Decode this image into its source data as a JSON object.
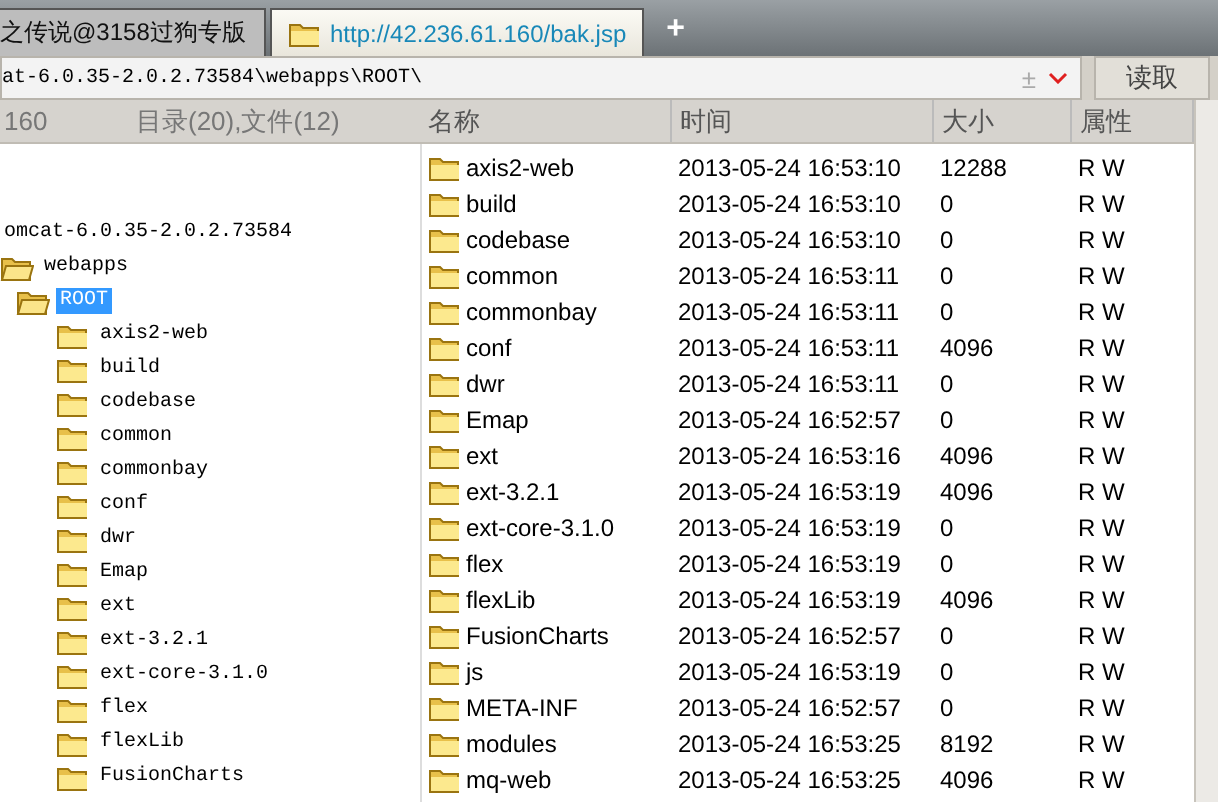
{
  "tabs": [
    {
      "label": "之传说@3158过狗专版",
      "selected": false
    },
    {
      "label": "http://42.236.61.160/bak.jsp",
      "selected": true
    }
  ],
  "new_tab": "+",
  "address": {
    "value": "at-6.0.35-2.0.2.73584\\webapps\\ROOT\\",
    "toggle": "±",
    "button": "读取"
  },
  "left_header": {
    "ip": "160",
    "summary": "目录(20),文件(12)"
  },
  "tree": [
    {
      "name": "omcat-6.0.35-2.0.2.73584",
      "selected": false,
      "children": [
        {
          "name": "webapps",
          "selected": false,
          "children": [
            {
              "name": "ROOT",
              "selected": true,
              "children": [
                {
                  "name": "axis2-web",
                  "selected": false
                },
                {
                  "name": "build",
                  "selected": false
                },
                {
                  "name": "codebase",
                  "selected": false
                },
                {
                  "name": "common",
                  "selected": false
                },
                {
                  "name": "commonbay",
                  "selected": false
                },
                {
                  "name": "conf",
                  "selected": false
                },
                {
                  "name": "dwr",
                  "selected": false
                },
                {
                  "name": "Emap",
                  "selected": false
                },
                {
                  "name": "ext",
                  "selected": false
                },
                {
                  "name": "ext-3.2.1",
                  "selected": false
                },
                {
                  "name": "ext-core-3.1.0",
                  "selected": false
                },
                {
                  "name": "flex",
                  "selected": false
                },
                {
                  "name": "flexLib",
                  "selected": false
                },
                {
                  "name": "FusionCharts",
                  "selected": false
                }
              ]
            }
          ]
        }
      ]
    }
  ],
  "table": {
    "columns": [
      "名称",
      "时间",
      "大小",
      "属性"
    ],
    "rows": [
      [
        "axis2-web",
        "2013-05-24 16:53:10",
        "12288",
        "R W"
      ],
      [
        "build",
        "2013-05-24 16:53:10",
        "0",
        "R W"
      ],
      [
        "codebase",
        "2013-05-24 16:53:10",
        "0",
        "R W"
      ],
      [
        "common",
        "2013-05-24 16:53:11",
        "0",
        "R W"
      ],
      [
        "commonbay",
        "2013-05-24 16:53:11",
        "0",
        "R W"
      ],
      [
        "conf",
        "2013-05-24 16:53:11",
        "4096",
        "R W"
      ],
      [
        "dwr",
        "2013-05-24 16:53:11",
        "0",
        "R W"
      ],
      [
        "Emap",
        "2013-05-24 16:52:57",
        "0",
        "R W"
      ],
      [
        "ext",
        "2013-05-24 16:53:16",
        "4096",
        "R W"
      ],
      [
        "ext-3.2.1",
        "2013-05-24 16:53:19",
        "4096",
        "R W"
      ],
      [
        "ext-core-3.1.0",
        "2013-05-24 16:53:19",
        "0",
        "R W"
      ],
      [
        "flex",
        "2013-05-24 16:53:19",
        "0",
        "R W"
      ],
      [
        "flexLib",
        "2013-05-24 16:53:19",
        "4096",
        "R W"
      ],
      [
        "FusionCharts",
        "2013-05-24 16:52:57",
        "0",
        "R W"
      ],
      [
        "js",
        "2013-05-24 16:53:19",
        "0",
        "R W"
      ],
      [
        "META-INF",
        "2013-05-24 16:52:57",
        "0",
        "R W"
      ],
      [
        "modules",
        "2013-05-24 16:53:25",
        "8192",
        "R W"
      ],
      [
        "mq-web",
        "2013-05-24 16:53:25",
        "4096",
        "R W"
      ]
    ]
  }
}
